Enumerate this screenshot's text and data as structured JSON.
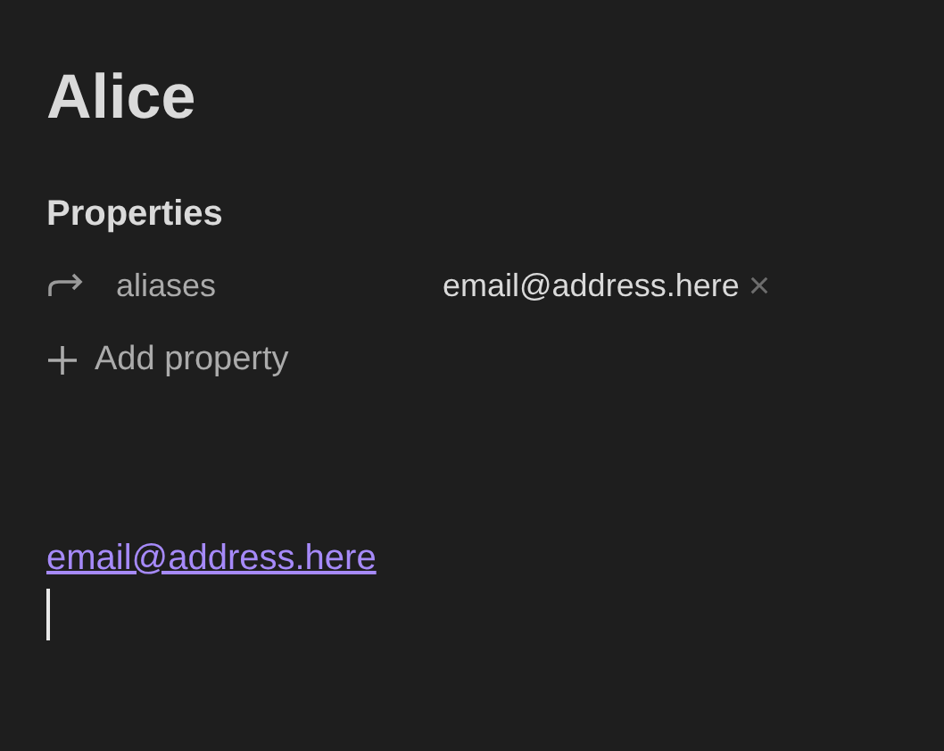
{
  "note": {
    "title": "Alice"
  },
  "properties": {
    "heading": "Properties",
    "items": [
      {
        "name": "aliases",
        "value": "email@address.here",
        "remove": "×"
      }
    ],
    "add_label": "Add property"
  },
  "body": {
    "link": "email@address.here"
  }
}
